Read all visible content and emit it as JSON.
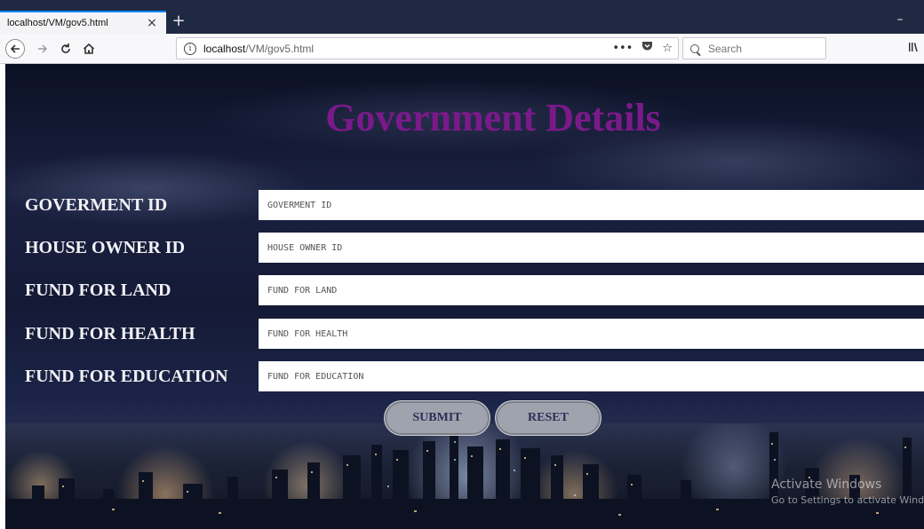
{
  "browser": {
    "tab_title": "localhost/VM/gov5.html",
    "tab_close": "×",
    "new_tab": "+",
    "minimize": "–",
    "url_host": "localhost",
    "url_path": "/VM/gov5.html",
    "search_placeholder": "Search",
    "page_actions": "•••"
  },
  "page": {
    "title": "Government Details",
    "fields": [
      {
        "label": "GOVERMENT ID",
        "placeholder": "GOVERMENT ID"
      },
      {
        "label": "HOUSE OWNER ID",
        "placeholder": "HOUSE OWNER ID"
      },
      {
        "label": "FUND FOR LAND",
        "placeholder": "FUND FOR LAND"
      },
      {
        "label": "FUND FOR HEALTH",
        "placeholder": "FUND FOR HEALTH"
      },
      {
        "label": "FUND FOR EDUCATION",
        "placeholder": "FUND FOR EDUCATION"
      }
    ],
    "submit_label": "SUBMIT",
    "reset_label": "RESET",
    "title_color": "#7a1a8a"
  },
  "watermark": {
    "title": "Activate Windows",
    "subtitle": "Go to Settings to activate Windo"
  }
}
